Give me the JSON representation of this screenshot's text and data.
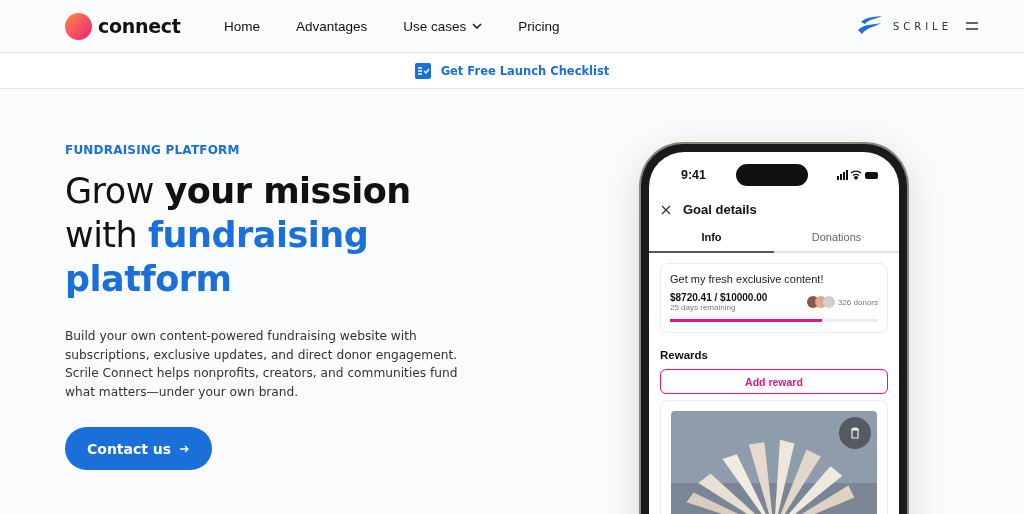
{
  "header": {
    "logo": "connect",
    "nav": [
      {
        "label": "Home",
        "has_menu": false
      },
      {
        "label": "Advantages",
        "has_menu": false
      },
      {
        "label": "Use cases",
        "has_menu": true
      },
      {
        "label": "Pricing",
        "has_menu": false
      }
    ],
    "brand": "SCRILE"
  },
  "banner": {
    "link": "Get Free Launch Checklist"
  },
  "hero": {
    "eyebrow": "FUNDRAISING PLATFORM",
    "headline": [
      {
        "text": "Grow ",
        "kind": "plain"
      },
      {
        "text": "your mission",
        "kind": "bold"
      },
      {
        "text": " with ",
        "kind": "plain"
      },
      {
        "text": "fundraising platform",
        "kind": "accent"
      }
    ],
    "description": "Build your own content-powered fundraising website with subscriptions, exclusive updates, and direct donor engagement. Scrile Connect helps nonprofits, creators, and communities fund what matters—under your own brand.",
    "button": "Contact us"
  },
  "phone": {
    "time": "9:41",
    "title": "Goal details",
    "tabs": [
      {
        "label": "Info",
        "selected": true
      },
      {
        "label": "Donations",
        "selected": false
      }
    ],
    "goal": {
      "title": "Get my fresh exclusive content!",
      "amount": "$8720.41 / $10000.00",
      "remaining": "25 days remaining",
      "donors": "326 donors",
      "level": 0.73
    },
    "rewards_title": "Rewards",
    "add_button": "Add reward"
  }
}
